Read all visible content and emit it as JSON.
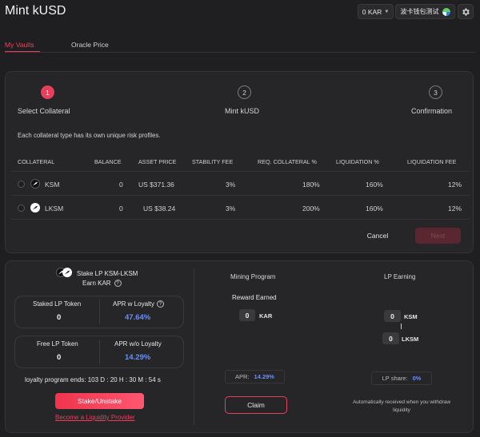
{
  "header": {
    "title": "Mint kUSD",
    "kar_balance": "0 KAR",
    "wallet_name": "波卡钱包测试"
  },
  "tabs": [
    {
      "label": "My Vaults",
      "active": true
    },
    {
      "label": "Oracle Price",
      "active": false
    }
  ],
  "steps": [
    {
      "number": "1",
      "label": "Select Collateral",
      "active": true
    },
    {
      "number": "2",
      "label": "Mint kUSD",
      "active": false
    },
    {
      "number": "3",
      "label": "Confirmation",
      "active": false
    }
  ],
  "collateral_description": "Each collateral type has its own unique risk profiles.",
  "table": {
    "headers": [
      "COLLATERAL",
      "BALANCE",
      "ASSET PRICE",
      "STABILITY FEE",
      "REQ. COLLATERAL %",
      "LIQUIDATION %",
      "LIQUIDATION FEE"
    ],
    "rows": [
      {
        "token": "KSM",
        "balance": "0",
        "price": "US $371.36",
        "stability_fee": "3%",
        "req_collateral": "180%",
        "liquidation": "160%",
        "liquidation_fee": "12%"
      },
      {
        "token": "LKSM",
        "balance": "0",
        "price": "US $38.24",
        "stability_fee": "3%",
        "req_collateral": "200%",
        "liquidation": "160%",
        "liquidation_fee": "12%"
      }
    ]
  },
  "actions": {
    "cancel": "Cancel",
    "next": "Next"
  },
  "staking": {
    "title": "Stake LP KSM-LKSM",
    "earn": "Earn KAR",
    "staked_label": "Staked LP Token",
    "staked_value": "0",
    "apr_loyalty_label": "APR w Loyalty",
    "apr_loyalty_value": "47.64%",
    "free_label": "Free LP Token",
    "free_value": "0",
    "apr_no_loyalty_label": "APR w/o Loyalty",
    "apr_no_loyalty_value": "14.29%",
    "loyalty_ends": "loyalty program ends: 103 D : 20 H : 30 M : 54 s",
    "stake_button": "Stake/Unstake",
    "provider_link": "Become a Liquidity Provider"
  },
  "mining": {
    "title": "Mining Program",
    "reward_label": "Reward Earned",
    "reward_value": "0",
    "reward_unit": "KAR",
    "apr_label": "APR:",
    "apr_value": "14.29%",
    "claim_button": "Claim"
  },
  "lp_earning": {
    "title": "LP Earning",
    "ksm_value": "0",
    "ksm_unit": "KSM",
    "lksm_value": "0",
    "lksm_unit": "LKSM",
    "share_label": "LP share:",
    "share_value": "0%",
    "note": "Automatically received when you withdraw liquidity"
  },
  "colors": {
    "accent": "#e8405a",
    "blue_value": "#6b8ef5",
    "background": "#1f1f21",
    "panel": "#262628"
  }
}
